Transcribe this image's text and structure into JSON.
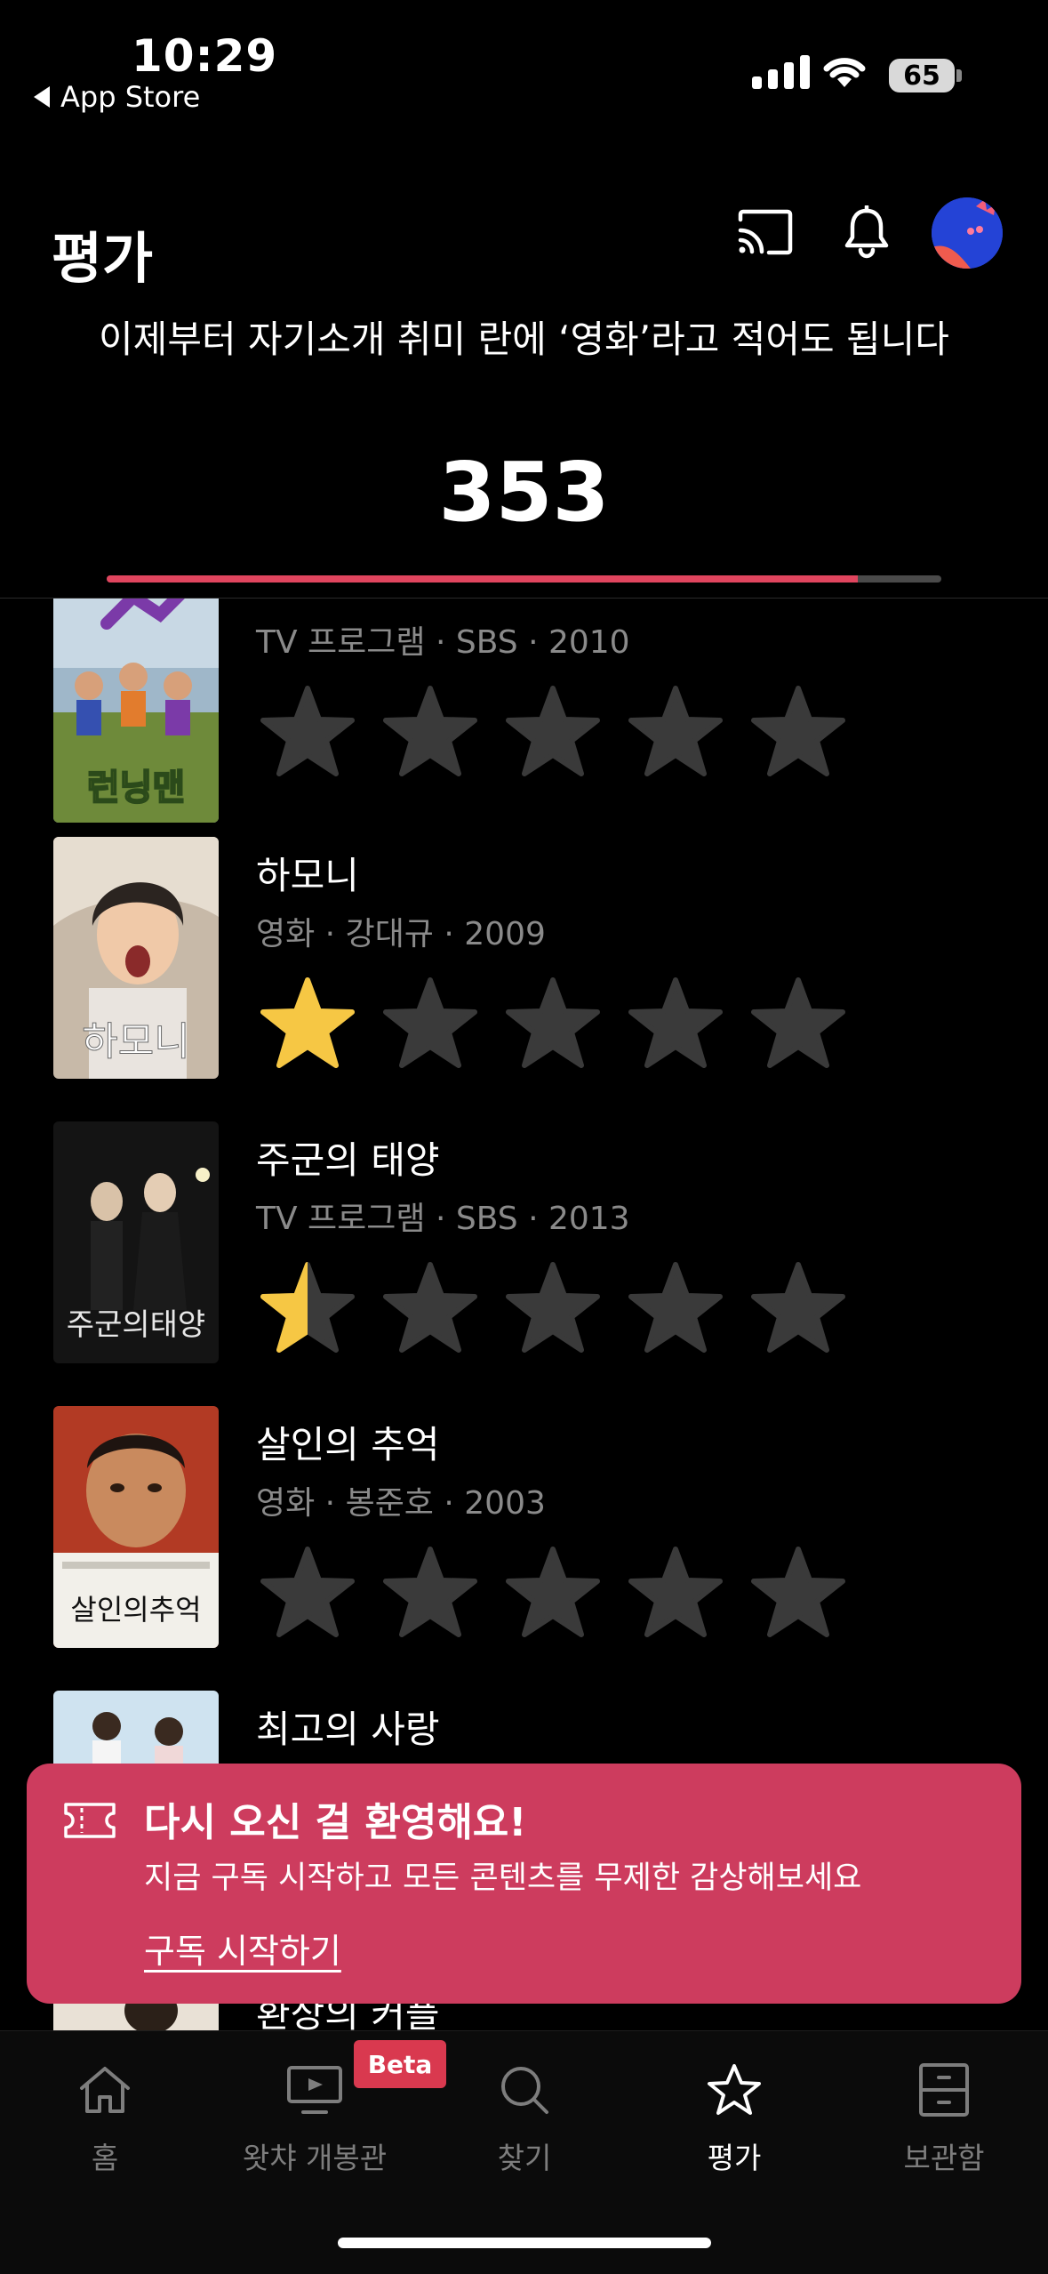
{
  "status_bar": {
    "time": "10:29",
    "back_label": "App Store",
    "battery": "65"
  },
  "header": {
    "title": "평가"
  },
  "summary": {
    "message": "이제부터 자기소개 취미 란에 ‘영화’라고 적어도 됩니다",
    "count": "353",
    "progress": 0.9
  },
  "items": [
    {
      "title": "",
      "meta": "TV 프로그램 · SBS · 2010",
      "rating": 0,
      "poster_text": "런닝맨"
    },
    {
      "title": "하모니",
      "meta": "영화 · 강대규 · 2009",
      "rating": 1,
      "poster_text": "하모니"
    },
    {
      "title": "주군의 태양",
      "meta": "TV 프로그램 · SBS · 2013",
      "rating": 0.5,
      "poster_text": "주군의태양"
    },
    {
      "title": "살인의 추억",
      "meta": "영화 · 봉준호 · 2003",
      "rating": 0,
      "poster_text": "살인의추억"
    },
    {
      "title": "최고의 사랑",
      "meta": "",
      "rating": 0,
      "poster_text": ""
    }
  ],
  "toast": {
    "title": "다시 오신 걸 환영해요!",
    "body": "지금 구독 시작하고 모든 콘텐츠를 무제한 감상해보세요",
    "link": "구독 시작하기"
  },
  "partial_item_title": "환상의 커플",
  "tabs": [
    {
      "label": "홈",
      "icon": "home-icon"
    },
    {
      "label": "왓챠 개봉관",
      "icon": "theater-icon",
      "badge": "Beta"
    },
    {
      "label": "찾기",
      "icon": "search-icon"
    },
    {
      "label": "평가",
      "icon": "star-icon",
      "active": true
    },
    {
      "label": "보관함",
      "icon": "locker-icon"
    }
  ],
  "colors": {
    "accent": "#e0455e",
    "star_filled": "#f6c744",
    "star_empty": "#3a3a3a",
    "toast_bg": "#cd3c5e"
  }
}
